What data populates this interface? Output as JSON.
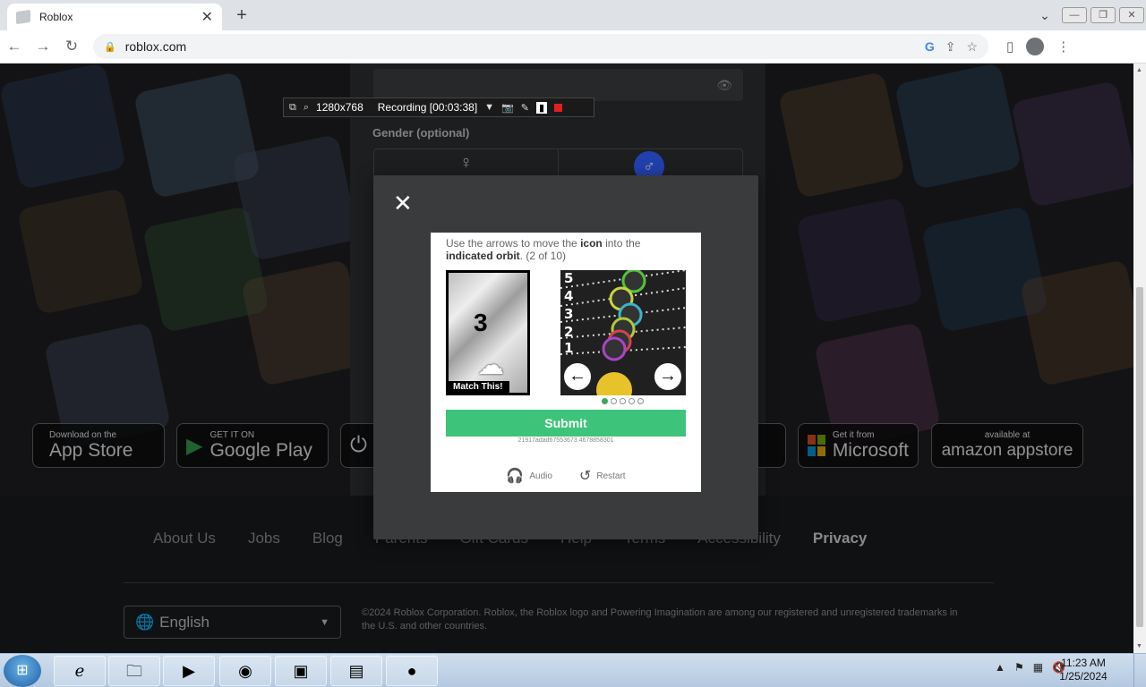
{
  "browser": {
    "tab_title": "Roblox",
    "tab_close": "✕",
    "new_tab": "+",
    "url": "roblox.com",
    "window_buttons": [
      "—",
      "❐",
      "✕"
    ]
  },
  "page": {
    "gender_label": "Gender (optional)",
    "stores": [
      {
        "small": "Download on the",
        "big": "App Store",
        "icon": "apple-icon"
      },
      {
        "small": "GET IT ON",
        "big": "Google Play",
        "icon": "google-play-icon"
      },
      {
        "small": "Get it from",
        "big": "Microsoft",
        "icon": "microsoft-icon"
      },
      {
        "small": "available at",
        "big": "amazon appstore",
        "icon": "amazon-icon"
      }
    ],
    "footer_links": [
      "About Us",
      "Jobs",
      "Blog",
      "Parents",
      "Gift Cards",
      "Help",
      "Terms",
      "Accessibility",
      "Privacy"
    ],
    "language": "English",
    "copyright": "©2024 Roblox Corporation. Roblox, the Roblox logo and Powering Imagination are among our registered and unregistered trademarks in the U.S. and other countries."
  },
  "captcha": {
    "instruction_1": "Use the arrows to move the ",
    "instruction_icon": "icon",
    "instruction_2": " into the ",
    "instruction_orbit": "indicated orbit",
    "instruction_3": ". (2 of 10)",
    "ref_number": "3",
    "ref_label": "Match This!",
    "orbit_numbers": [
      "5",
      "4",
      "3",
      "2",
      "1"
    ],
    "submit_label": "Submit",
    "session_id": "21917adad67553673.4678858301",
    "audio_label": "Audio",
    "restart_label": "Restart",
    "page_dots": 5,
    "active_dot": 0
  },
  "recorder": {
    "resolution": "1280x768",
    "status": "Recording [00:03:38]"
  },
  "taskbar": {
    "time": "11:23 AM",
    "date": "1/25/2024"
  },
  "colors": {
    "submit": "#3ec47a",
    "modal": "#393b3d",
    "footer_bg": "#191a1b",
    "accent_blue": "#335fff"
  }
}
